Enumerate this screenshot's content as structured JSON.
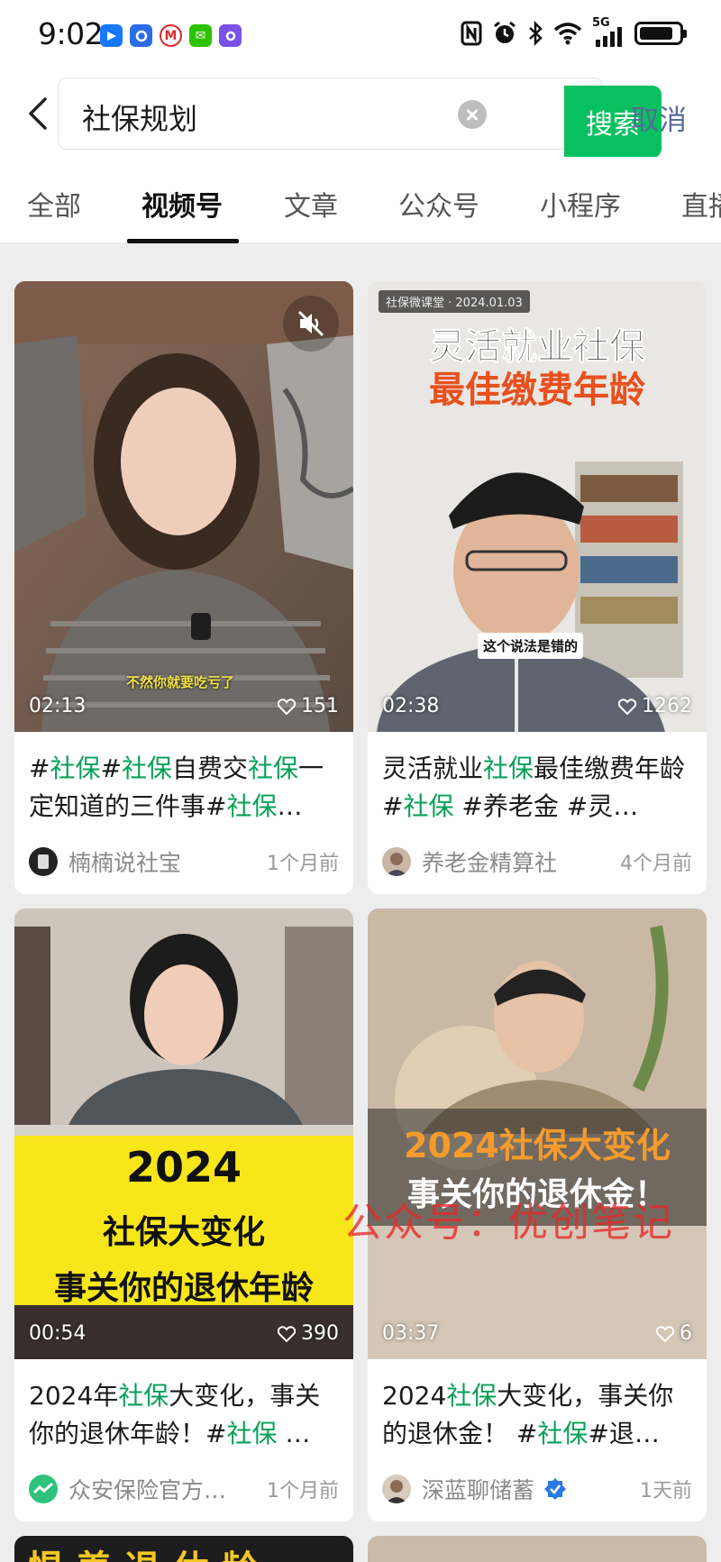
{
  "status_bar": {
    "time": "9:02",
    "network": "5G",
    "battery_level": 0.85,
    "notification_icons": [
      "feishu-icon",
      "tencent-meeting-icon",
      "metro-icon",
      "wechat-icon",
      "assistant-icon"
    ],
    "metro_glyph": "M",
    "wechat_glyph": "✉"
  },
  "search": {
    "query": "社保规划",
    "search_label": "搜索",
    "cancel_label": "取消"
  },
  "tabs": [
    {
      "label": "全部",
      "active": false
    },
    {
      "label": "视频号",
      "active": true
    },
    {
      "label": "文章",
      "active": false
    },
    {
      "label": "公众号",
      "active": false
    },
    {
      "label": "小程序",
      "active": false
    },
    {
      "label": "直播",
      "active": false
    }
  ],
  "cards": [
    {
      "duration": "02:13",
      "likes": "151",
      "overlay_caption": "不然你就要吃亏了",
      "title_parts": [
        {
          "t": "#"
        },
        {
          "t": "社保",
          "kw": true
        },
        {
          "t": "#"
        },
        {
          "t": "社保",
          "kw": true
        },
        {
          "t": "自费交"
        },
        {
          "t": "社保",
          "kw": true
        },
        {
          "t": "一定知道的三件事#"
        },
        {
          "t": "社保",
          "kw": true
        },
        {
          "t": "…"
        }
      ],
      "author": "楠楠说社宝",
      "time": "1个月前",
      "verified": false
    },
    {
      "duration": "02:38",
      "likes": "1262",
      "overlay_top": "社保微课堂 · 2024.01.03",
      "overlay_line1": "灵活就业社保",
      "overlay_line2": "最佳缴费年龄",
      "overlay_caption": "这个说法是错的",
      "title_parts": [
        {
          "t": "灵活就业"
        },
        {
          "t": "社保",
          "kw": true
        },
        {
          "t": "最佳缴费年龄 #"
        },
        {
          "t": "社保",
          "kw": true
        },
        {
          "t": " #养老金 #灵…"
        }
      ],
      "author": "养老金精算社",
      "time": "4个月前",
      "verified": false
    },
    {
      "duration": "00:54",
      "likes": "390",
      "overlay_line1": "2024",
      "overlay_line2": "社保大变化",
      "overlay_line3": "事关你的退休年龄",
      "title_parts": [
        {
          "t": "2024年"
        },
        {
          "t": "社保",
          "kw": true
        },
        {
          "t": "大变化，事关你的退休年龄！#"
        },
        {
          "t": "社保",
          "kw": true
        },
        {
          "t": " …"
        }
      ],
      "author": "众安保险官方…",
      "time": "1个月前",
      "verified": false
    },
    {
      "duration": "03:37",
      "likes": "6",
      "overlay_line1": "2024社保大变化",
      "overlay_line2": "事关你的退休金！",
      "title_parts": [
        {
          "t": "2024"
        },
        {
          "t": "社保",
          "kw": true
        },
        {
          "t": "大变化，事关你的退休金！ #"
        },
        {
          "t": "社保",
          "kw": true
        },
        {
          "t": "#退…"
        }
      ],
      "author": "深蓝聊储蓄",
      "time": "1天前",
      "verified": true
    }
  ],
  "partial_bottom": {
    "left_text": "惧 养 退 休 龄"
  },
  "watermark": "公众号：优创笔记",
  "colors": {
    "accent": "#07c160",
    "keyword": "#07a058",
    "cancel": "#576b95",
    "watermark": "#e62828"
  }
}
